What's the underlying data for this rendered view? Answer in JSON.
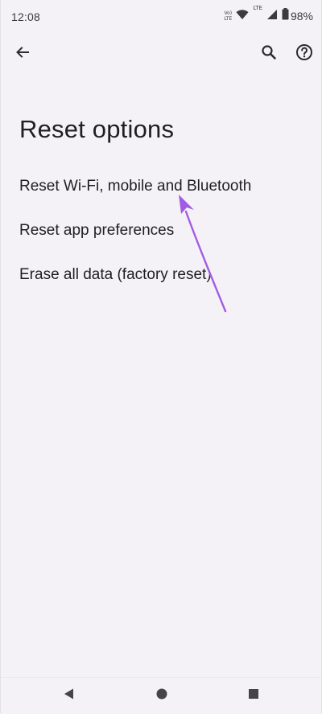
{
  "status_bar": {
    "time": "12:08",
    "volte_line1": "Vo)",
    "volte_line2": "LTE",
    "lte_label": "LTE",
    "battery_percent": "98%"
  },
  "app_bar": {
    "back_icon": "arrow-left-icon",
    "search_icon": "search-icon",
    "help_icon": "help-circle-icon"
  },
  "page": {
    "title": "Reset options"
  },
  "options": [
    {
      "label": "Reset Wi-Fi, mobile and Bluetooth"
    },
    {
      "label": "Reset app preferences"
    },
    {
      "label": "Erase all data (factory reset)"
    }
  ],
  "annotation": {
    "arrow_color": "#a35be6"
  },
  "nav_bar": {
    "back_icon": "triangle-back-icon",
    "home_icon": "circle-home-icon",
    "recents_icon": "square-recents-icon"
  }
}
